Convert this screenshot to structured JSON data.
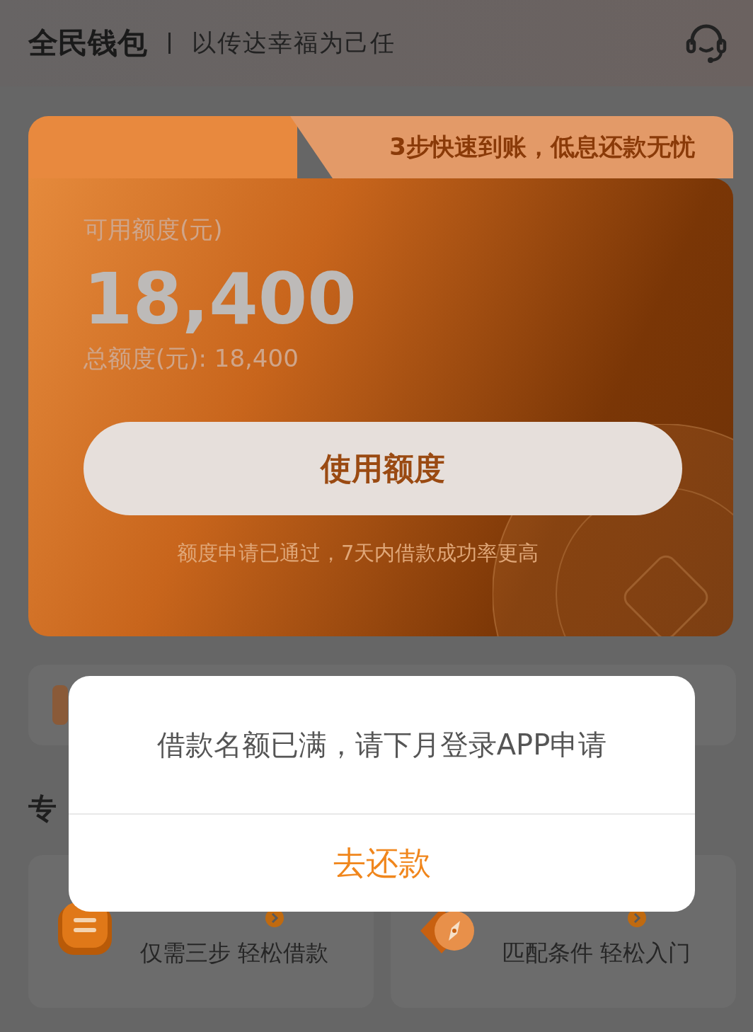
{
  "header": {
    "brand": "全民钱包",
    "slogan": "以传达幸福为己任"
  },
  "credit_card": {
    "tagline": "3步快速到账，低息还款无忧",
    "available_label": "可用额度(元)",
    "available_amount": "18,400",
    "total": "总额度(元): 18,400",
    "button": "使用额度",
    "note": "额度申请已通过，7天内借款成功率更高"
  },
  "section": {
    "title": "专"
  },
  "guides": [
    {
      "subtitle": "仅需三步 轻松借款"
    },
    {
      "subtitle": "匹配条件 轻松入门"
    }
  ],
  "dialog": {
    "message": "借款名额已满，请下月登录APP申请",
    "button": "去还款"
  }
}
